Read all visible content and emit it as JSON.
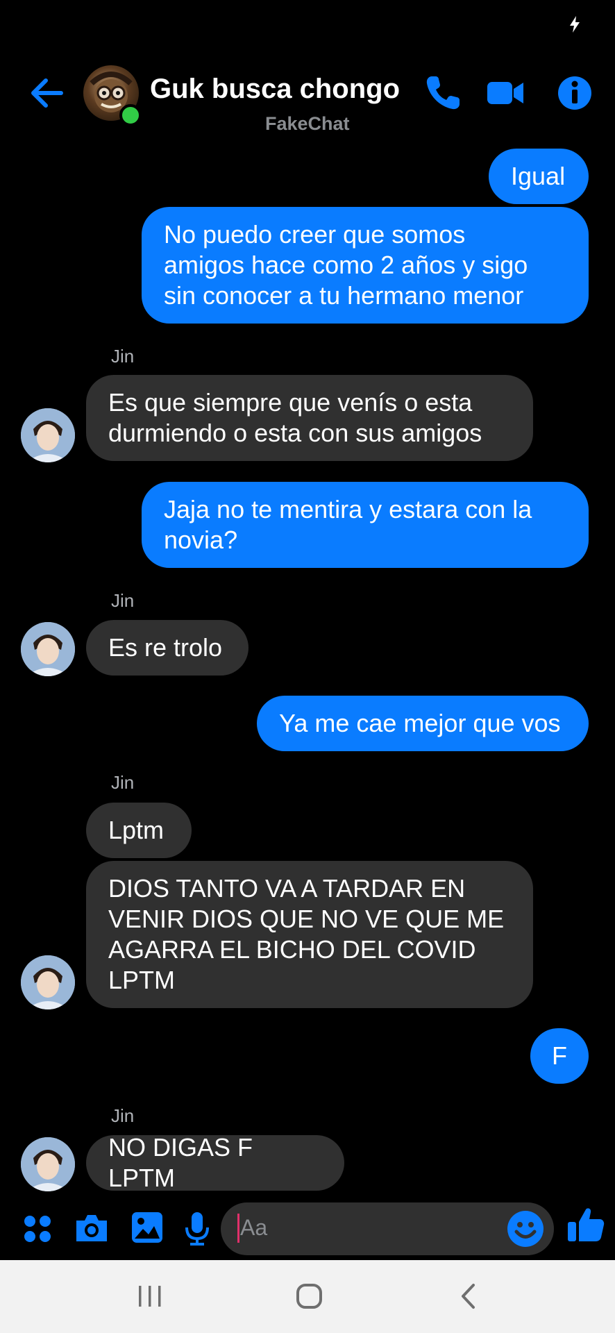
{
  "status_bar": {
    "icon": "flash-icon"
  },
  "header": {
    "title": "Guk busca chongo",
    "subtitle": "FakeChat",
    "accent_color": "#0a7cff",
    "online_color": "#31cc46",
    "icons": [
      "back-arrow-icon",
      "phone-icon",
      "video-camera-icon",
      "info-icon"
    ]
  },
  "messages": [
    {
      "from": "me",
      "text": "Igual"
    },
    {
      "from": "me",
      "text": "No puedo creer que somos\namigos hace como 2 años y sigo\nsin conocer a tu hermano menor"
    },
    {
      "from": "Jin",
      "sender_label": "Jin",
      "text": "Es que siempre que venís o esta\ndurmiendo o esta con sus amigos"
    },
    {
      "from": "me",
      "text": "Jaja no te mentira y estara con la\nnovia?"
    },
    {
      "from": "Jin",
      "sender_label": "Jin",
      "text": "Es re trolo"
    },
    {
      "from": "me",
      "text": "Ya me cae mejor que vos"
    },
    {
      "from": "Jin",
      "sender_label": "Jin",
      "text": "Lptm"
    },
    {
      "from": "Jin",
      "text": "DIOS TANTO VA A TARDAR EN\nVENIR DIOS QUE NO VE QUE ME\nAGARRA EL BICHO DEL COVID\nLPTM"
    },
    {
      "from": "me",
      "text": "F"
    },
    {
      "from": "Jin",
      "sender_label": "Jin",
      "text": "NO DIGAS F LPTM"
    }
  ],
  "composer": {
    "placeholder": "Aa",
    "icons": [
      "apps-icon",
      "camera-icon",
      "gallery-icon",
      "microphone-icon",
      "emoji-icon",
      "thumbs-up-icon"
    ]
  },
  "nav_bar": {
    "icons": [
      "recent-apps-icon",
      "home-icon",
      "back-icon"
    ]
  }
}
